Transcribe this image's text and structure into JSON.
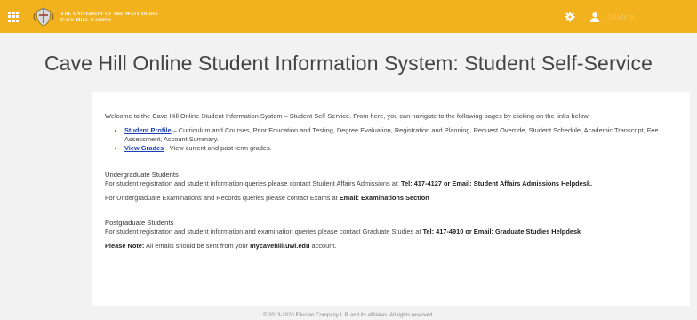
{
  "header": {
    "university_line1": "The University of the West Indies",
    "university_line2": "Cave Hill Campus",
    "user_name": "Student"
  },
  "page_title": "Cave Hill Online Student Information System: Student Self-Service",
  "intro": "Welcome to the Cave Hill Online Student Information System – Student Self-Service. From here, you can navigate to the following pages by clicking on the links below:",
  "links": [
    {
      "label": "Student Profile",
      "description": " – Curriculum and Courses, Prior Education and Testing, Degree Evaluation, Registration and Planning, Request Override, Student Schedule, Academic Transcript, Fee Assessment, Account Summary."
    },
    {
      "label": "View Grades",
      "description": " - View current and past term grades."
    }
  ],
  "undergrad": {
    "heading": "Undergraduate Students",
    "line1_prefix": "For student registration and student information queries please contact Student Affairs Admissions at: ",
    "line1_bold1": "Tel: 417-4127 or Email:",
    "line1_bold2": " Student Affairs Admissions Helpdesk.",
    "line2_prefix": "For Undergraduate Examinations and Records queries please contact Exams at ",
    "line2_bold": "Email: Examinations Section"
  },
  "postgrad": {
    "heading": "Postgraduate Students",
    "line1_prefix": "For student registration and student information and examination queries please contact Graduate Studies at ",
    "line1_bold1": "Tel: 417-4910 or Email:",
    "line1_bold2": " Graduate Studies Helpdesk"
  },
  "note": {
    "label": "Please Note:",
    "text_prefix": " All emails should be sent from your ",
    "domain": "mycavehill.uwi.edu",
    "text_suffix": " account."
  },
  "footer": "© 2013-2020 Ellucian Company L.P. and its affiliates. All rights reserved."
}
